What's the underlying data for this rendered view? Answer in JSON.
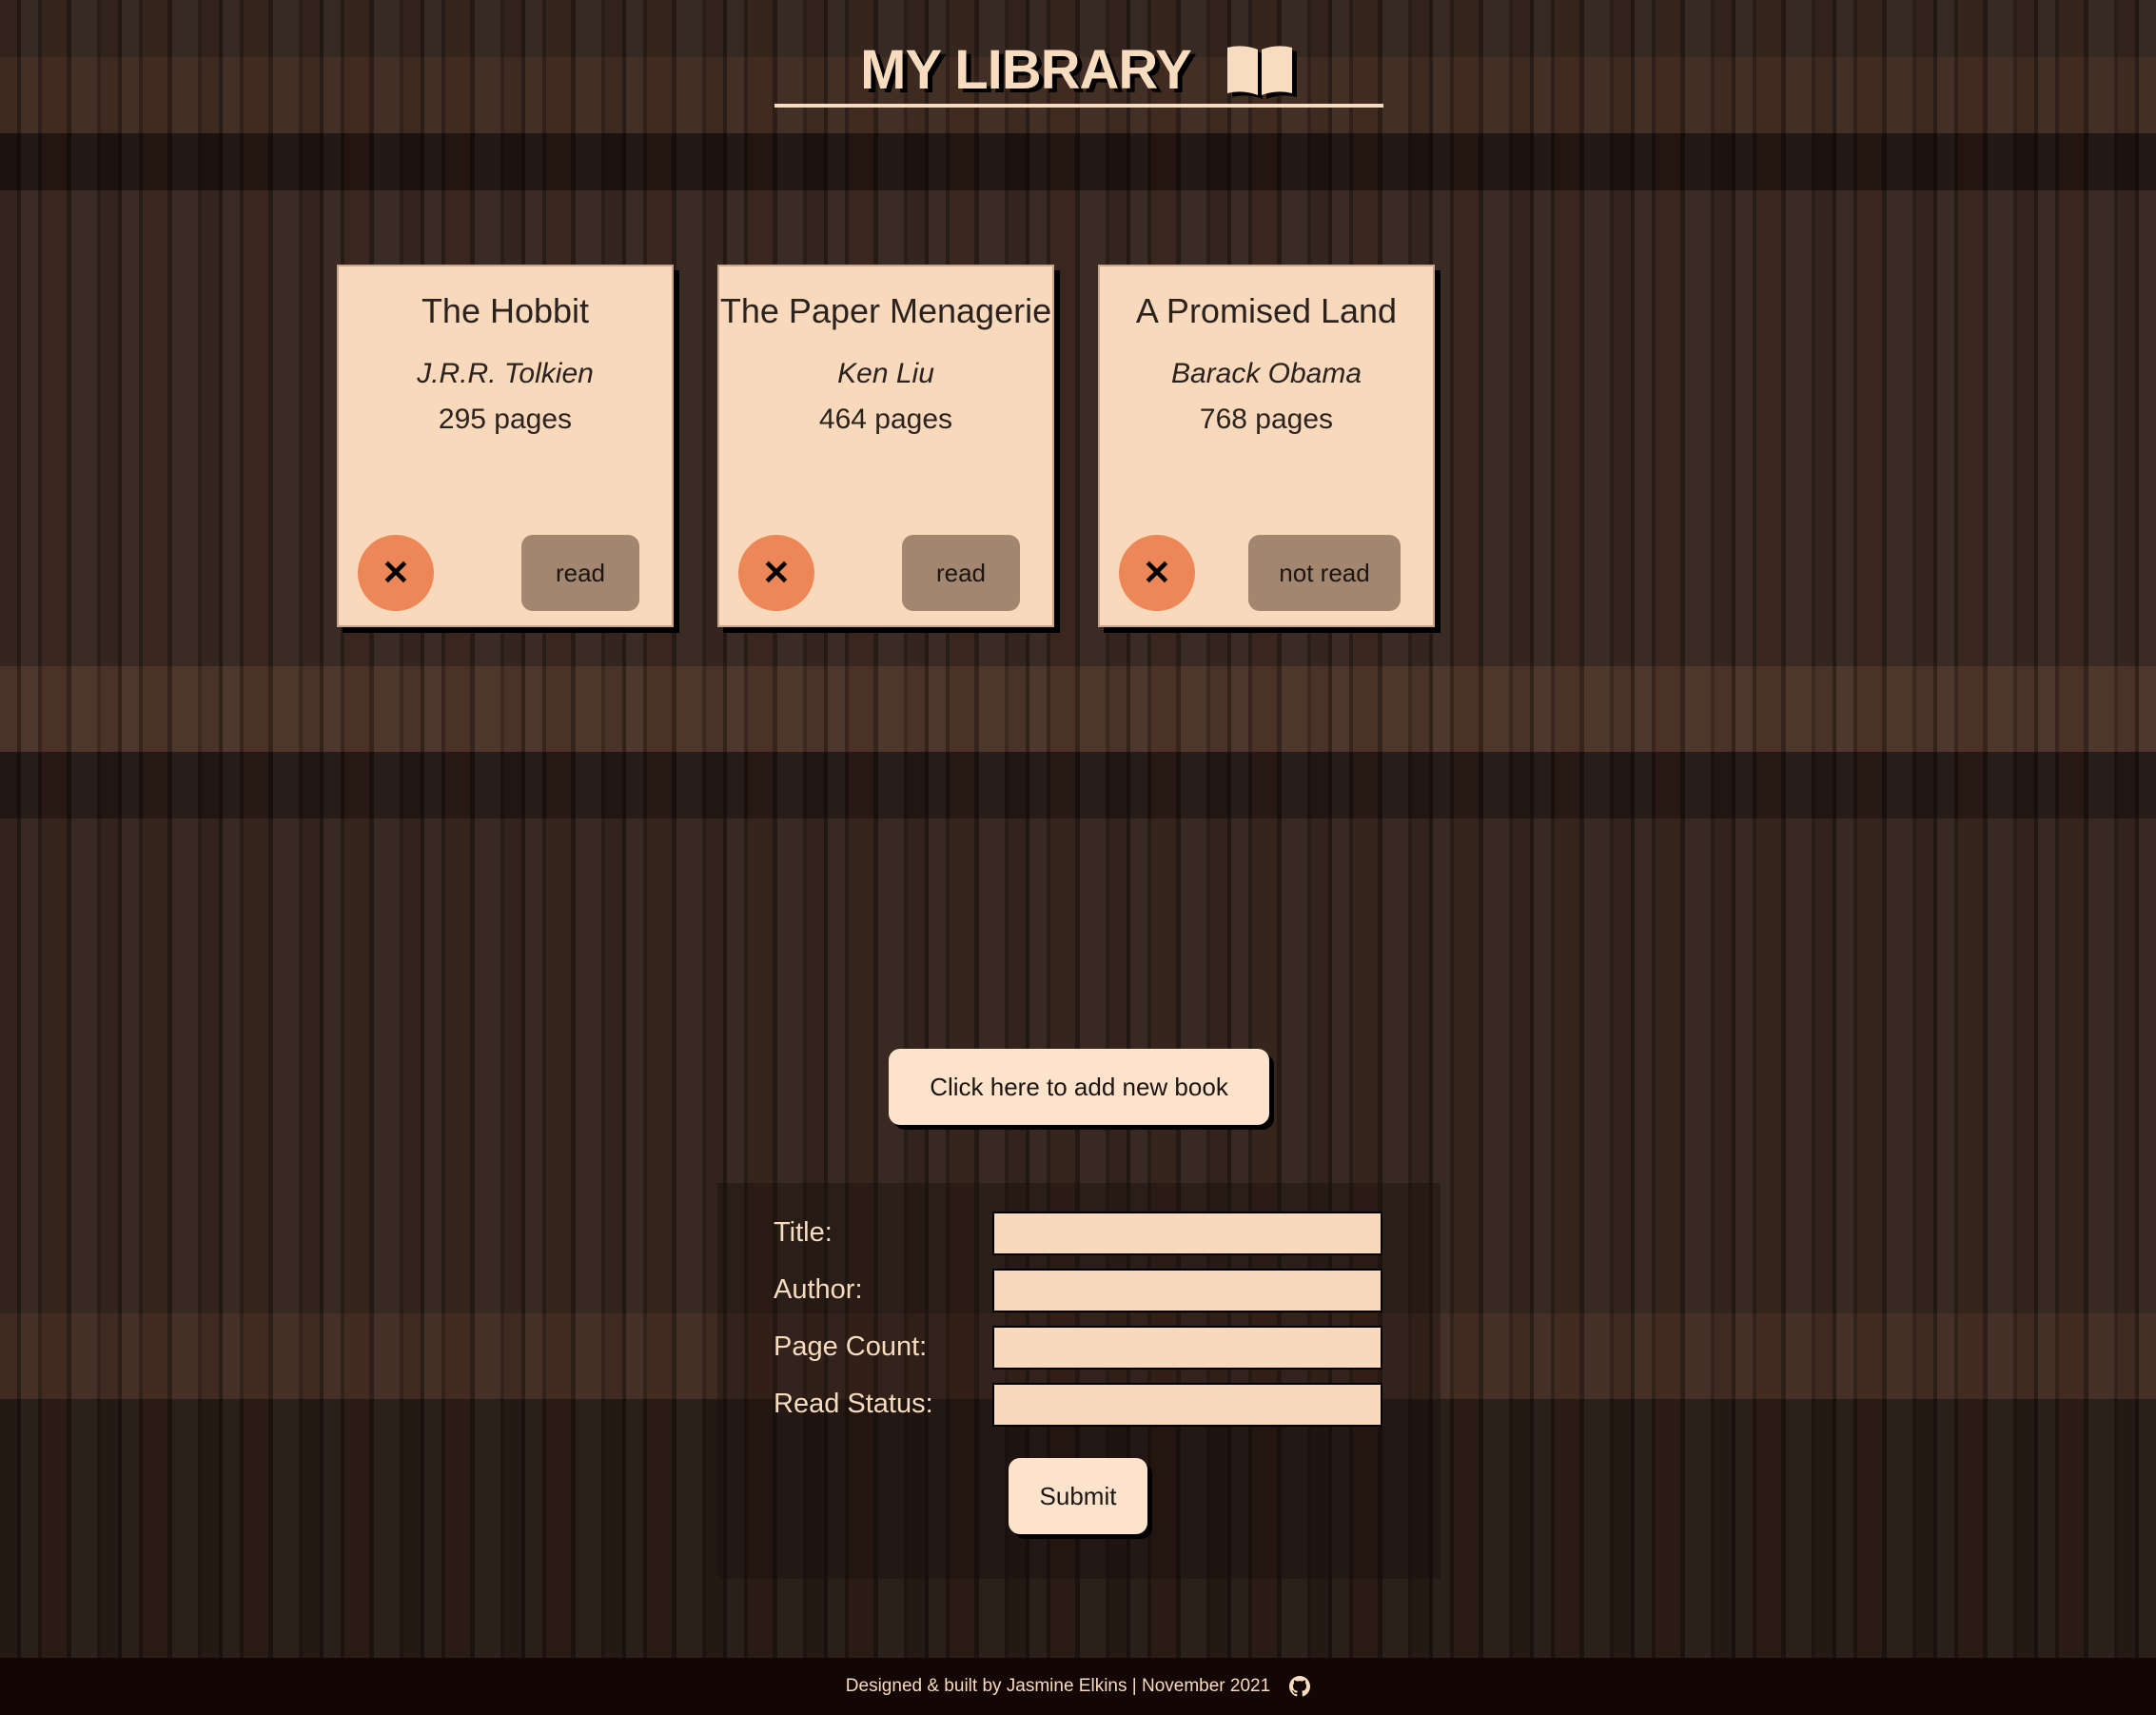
{
  "header": {
    "title": "MY LIBRARY"
  },
  "books": [
    {
      "title": "The Hobbit",
      "author": "J.R.R. Tolkien",
      "pages": "295 pages",
      "status": "read",
      "delete_glyph": "✕"
    },
    {
      "title": "The Paper Menagerie",
      "author": "Ken Liu",
      "pages": "464 pages",
      "status": "read",
      "delete_glyph": "✕"
    },
    {
      "title": "A Promised Land",
      "author": "Barack Obama",
      "pages": "768 pages",
      "status": "not read",
      "delete_glyph": "✕"
    }
  ],
  "add_button": {
    "label": "Click here to add new book"
  },
  "form": {
    "title_label": "Title:",
    "author_label": "Author:",
    "pages_label": "Page Count:",
    "status_label": "Read Status:",
    "title_value": "",
    "author_value": "",
    "pages_value": "",
    "status_value": "",
    "submit_label": "Submit"
  },
  "footer": {
    "credit": "Designed & built by Jasmine Elkins | November 2021",
    "icon": "github-icon"
  },
  "colors": {
    "card": "#f9d9bb",
    "delete": "#ee8758",
    "status": "#a38670",
    "text_light": "#f8dcbf",
    "footer": "#140605"
  }
}
